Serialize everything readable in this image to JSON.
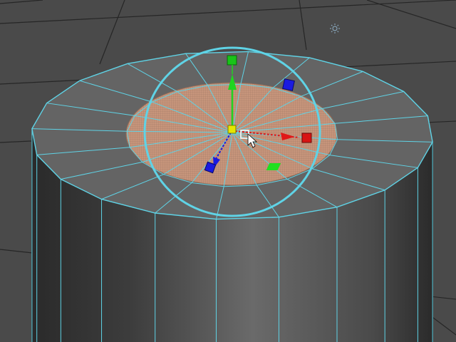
{
  "viewport": {
    "background": "#4a4a4a",
    "grid_color": "#262626",
    "wire_color": "#5fd3e6",
    "face_selected_color": "#c9977a",
    "cylinder_side_dark": "#2f2f2f",
    "cylinder_side_light": "#6e6e6e",
    "cap_color": "#646464",
    "manipulator": {
      "x_axis_color": "#e01818",
      "y_axis_color": "#20d420",
      "z_axis_color": "#1a1ae0",
      "center_color": "#e6e600",
      "ring_color": "#5fd3e6",
      "plane_xz_color": "#20e020",
      "plane_xy_color": "#1a1ae0"
    },
    "cursor": "arrow-with-square",
    "light_icon": "sun-icon"
  }
}
